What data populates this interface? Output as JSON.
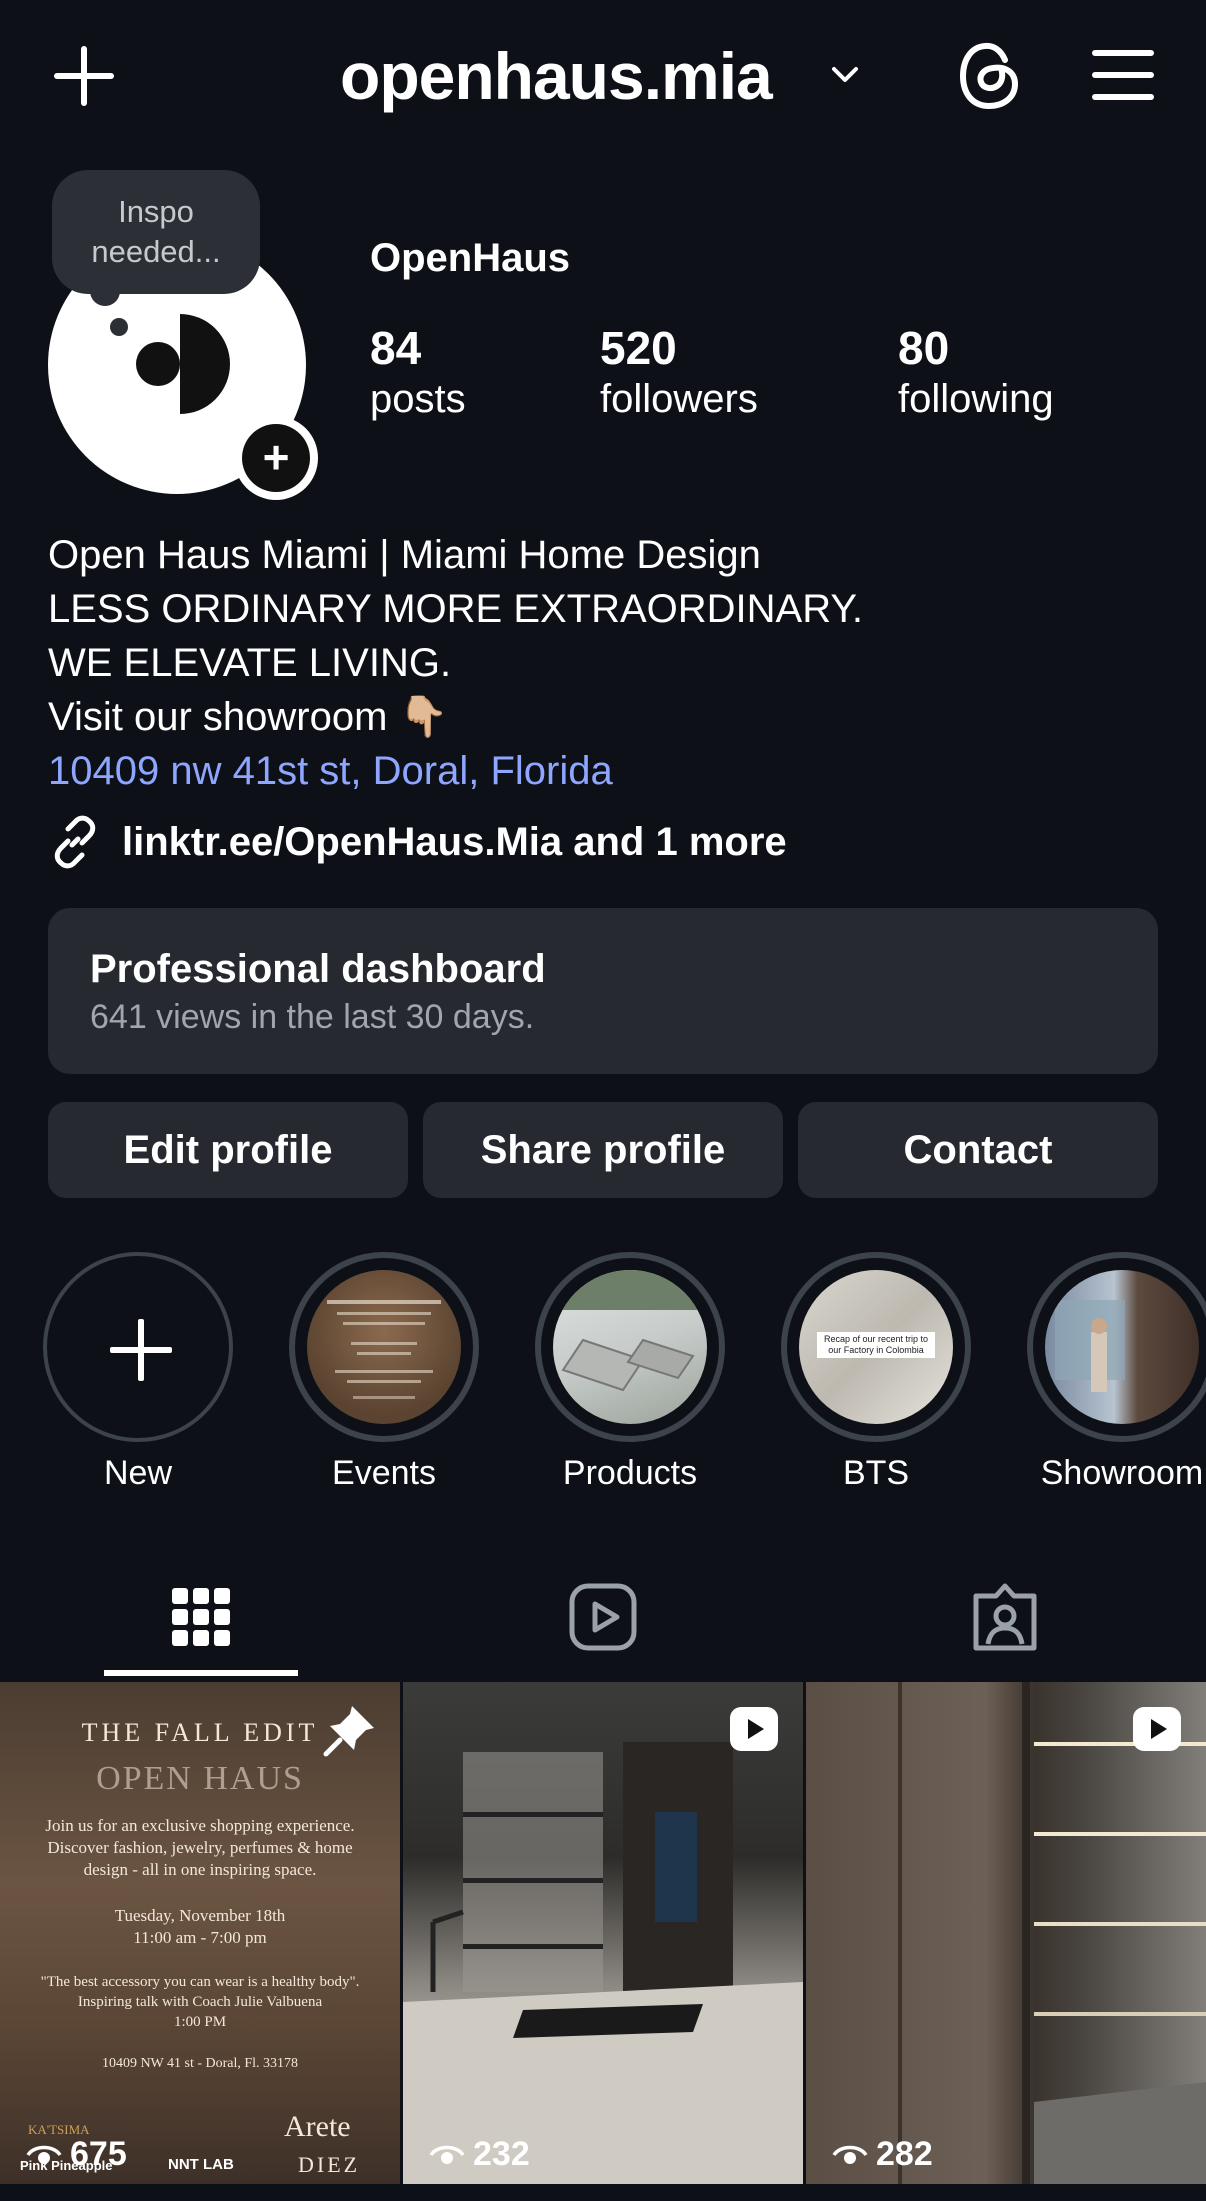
{
  "header": {
    "username": "openhaus.mia",
    "icons": [
      "plus-icon",
      "chevron-down-icon",
      "threads-icon",
      "menu-icon"
    ]
  },
  "note": {
    "text_line1": "Inspo",
    "text_line2": "needed..."
  },
  "profile": {
    "display_name": "OpenHaus",
    "stats": [
      {
        "value": "84",
        "label": "posts"
      },
      {
        "value": "520",
        "label": "followers"
      },
      {
        "value": "80",
        "label": "following"
      }
    ]
  },
  "bio": {
    "line1": "Open Haus Miami | Miami Home Design",
    "line2": "LESS ORDINARY MORE EXTRAORDINARY.",
    "line3": "WE ELEVATE LIVING.",
    "line4": "Visit our showroom 👇🏼",
    "address": "10409 nw 41st st, Doral, Florida",
    "link": "linktr.ee/OpenHaus.Mia and 1 more"
  },
  "dashboard": {
    "title": "Professional dashboard",
    "subtitle": "641 views in the last 30 days."
  },
  "buttons": {
    "edit": "Edit profile",
    "share": "Share profile",
    "contact": "Contact"
  },
  "highlights": [
    {
      "label": "New"
    },
    {
      "label": "Events"
    },
    {
      "label": "Products"
    },
    {
      "label": "BTS"
    },
    {
      "label": "Showroom"
    }
  ],
  "highlight_texts": {
    "bts_caption": "Recap of our recent trip to our Factory in Colombia"
  },
  "tabs": [
    "grid-icon",
    "reels-icon",
    "tagged-icon"
  ],
  "posts": [
    {
      "views": "675",
      "pinned": true,
      "texts": {
        "title": "THE FALL EDIT",
        "brand": "OPEN HAUS",
        "desc1": "Join us for an exclusive shopping experience.",
        "desc2": "Discover fashion, jewelry, perfumes & home",
        "desc3": "design - all in one inspiring space.",
        "date": "Tuesday, November 18th",
        "time": "11:00 am - 7:00 pm",
        "quote": "\"The best accessory you can wear is a healthy body\".",
        "talk": "Inspiring talk with Coach Julie Valbuena",
        "talk_time": "1:00 PM",
        "addr": "10409 NW 41 st - Doral, Fl. 33178",
        "logo1": "KA'TSIMA",
        "logo2": "NNT LAB",
        "logo3": "Arete",
        "logo4": "DIEZ",
        "logo5": "Pink Pineapple"
      }
    },
    {
      "views": "232",
      "reel": true
    },
    {
      "views": "282",
      "reel": true
    }
  ]
}
